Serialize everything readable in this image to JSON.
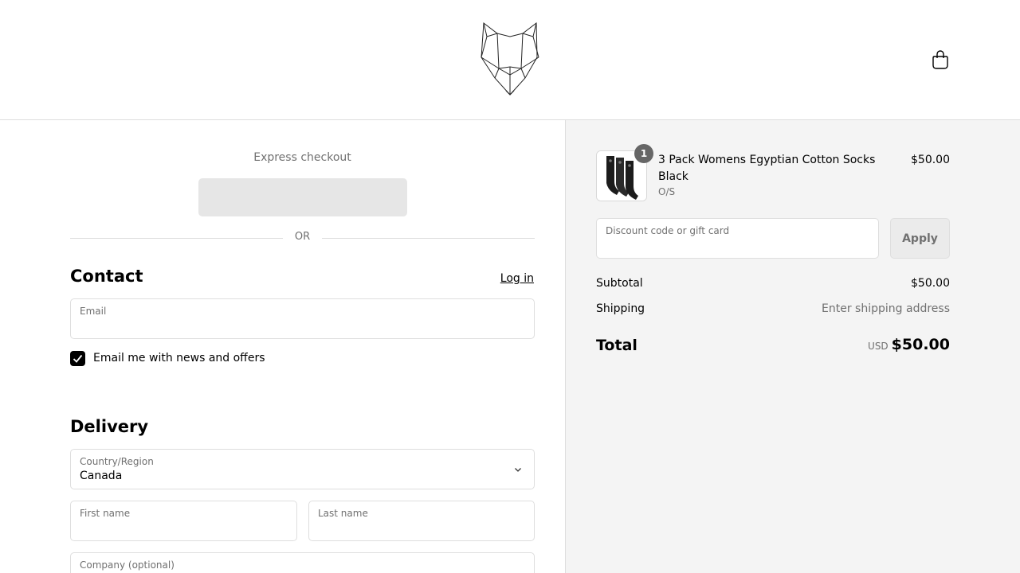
{
  "header": {
    "logo": "wolf-head-logo",
    "cart_icon": "shopping-bag-icon"
  },
  "checkout": {
    "express_title": "Express checkout",
    "or_text": "OR",
    "contact": {
      "heading": "Contact",
      "login_link": "Log in",
      "email_label": "Email",
      "email_value": "",
      "newsletter_label": "Email me with news and offers",
      "newsletter_checked": true
    },
    "delivery": {
      "heading": "Delivery",
      "country_label": "Country/Region",
      "country_value": "Canada",
      "first_name_label": "First name",
      "last_name_label": "Last name",
      "company_label": "Company (optional)"
    }
  },
  "summary": {
    "item": {
      "quantity": "1",
      "name": "3 Pack Womens Egyptian Cotton Socks Black",
      "variant": "O/S",
      "price": "$50.00"
    },
    "discount_label": "Discount code or gift card",
    "apply_label": "Apply",
    "subtotal_label": "Subtotal",
    "subtotal_value": "$50.00",
    "shipping_label": "Shipping",
    "shipping_value": "Enter shipping address",
    "total_label": "Total",
    "currency": "USD",
    "total_value": "$50.00"
  },
  "colors": {
    "summary_bg": "#f4f4f4",
    "border": "#dedede",
    "muted_text": "#707070",
    "badge": "#666666"
  }
}
